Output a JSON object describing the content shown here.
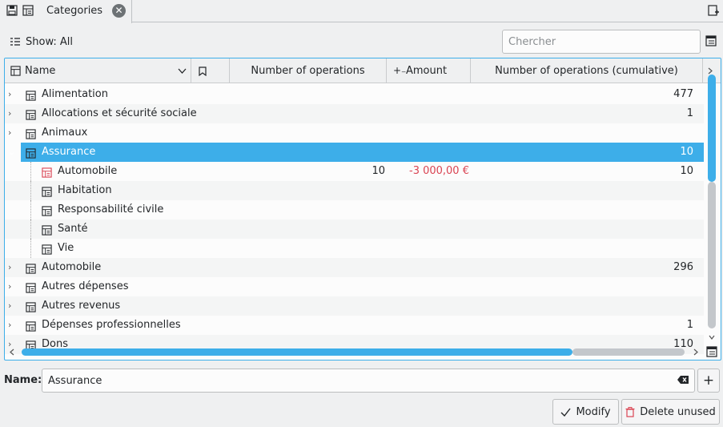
{
  "tab": {
    "label": "Categories",
    "close_glyph": "✕"
  },
  "toolbar": {
    "show_label": "Show: All",
    "search_placeholder": "Chercher"
  },
  "table": {
    "columns": [
      "Name",
      "Number of operations",
      "Amount",
      "Number of operations (cumulative)"
    ],
    "rows": [
      {
        "name": "Alimentation",
        "ops": "",
        "amount": "",
        "cumulative": "477",
        "expanded": false,
        "child": false
      },
      {
        "name": "Allocations et sécurité sociale",
        "ops": "",
        "amount": "",
        "cumulative": "1",
        "expanded": false,
        "child": false
      },
      {
        "name": "Animaux",
        "ops": "",
        "amount": "",
        "cumulative": "",
        "expanded": false,
        "child": false
      },
      {
        "name": "Assurance",
        "ops": "",
        "amount": "",
        "cumulative": "10",
        "expanded": true,
        "child": false,
        "selected": true
      },
      {
        "name": "Automobile",
        "ops": "10",
        "amount": "-3 000,00 €",
        "cumulative": "10",
        "child": true
      },
      {
        "name": "Habitation",
        "ops": "",
        "amount": "",
        "cumulative": "",
        "child": true
      },
      {
        "name": "Responsabilité civile",
        "ops": "",
        "amount": "",
        "cumulative": "",
        "child": true
      },
      {
        "name": "Santé",
        "ops": "",
        "amount": "",
        "cumulative": "",
        "child": true
      },
      {
        "name": "Vie",
        "ops": "",
        "amount": "",
        "cumulative": "",
        "child": true
      },
      {
        "name": "Automobile",
        "ops": "",
        "amount": "",
        "cumulative": "296",
        "expanded": false,
        "child": false
      },
      {
        "name": "Autres dépenses",
        "ops": "",
        "amount": "",
        "cumulative": "",
        "expanded": false,
        "child": false
      },
      {
        "name": "Autres revenus",
        "ops": "",
        "amount": "",
        "cumulative": "",
        "expanded": false,
        "child": false
      },
      {
        "name": "Dépenses professionnelles",
        "ops": "",
        "amount": "",
        "cumulative": "1",
        "expanded": false,
        "child": false
      },
      {
        "name": "Dons",
        "ops": "",
        "amount": "",
        "cumulative": "110",
        "expanded": false,
        "child": false
      }
    ]
  },
  "form": {
    "name_label": "Name:",
    "name_value": "Assurance"
  },
  "buttons": {
    "modify": "Modify",
    "delete_unused": "Delete unused"
  },
  "colors": {
    "accent": "#3daee9",
    "negative": "#da4453"
  }
}
